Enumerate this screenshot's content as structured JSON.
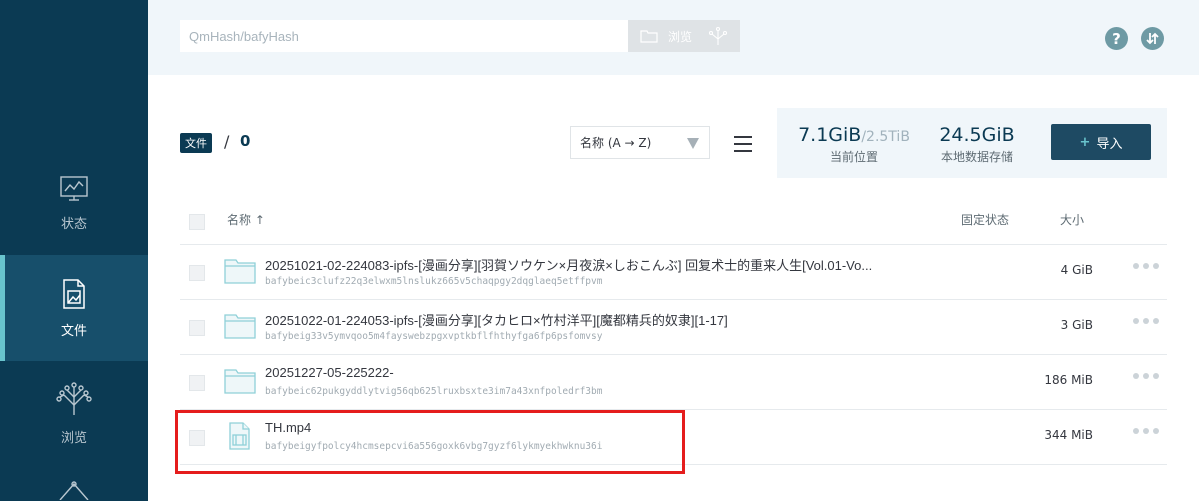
{
  "sidebar": {
    "items": [
      {
        "id": "status",
        "label": "状态",
        "icon": "chart-monitor-icon",
        "active": false
      },
      {
        "id": "files",
        "label": "文件",
        "icon": "document-icon",
        "active": true
      },
      {
        "id": "explore",
        "label": "浏览",
        "icon": "tree-graph-icon",
        "active": false
      },
      {
        "id": "peers",
        "label": "",
        "icon": "hexagon-network-icon",
        "active": false
      }
    ]
  },
  "header": {
    "search_placeholder": "QmHash/bafyHash",
    "browse_label": "浏览"
  },
  "breadcrumb": {
    "root": "文件",
    "separator": "/",
    "current": "0"
  },
  "sort": {
    "selected": "名称 (A → Z)"
  },
  "stats": {
    "current_value": "7.1GiB",
    "current_total": "/2.5TiB",
    "current_label": "当前位置",
    "local_value": "24.5GiB",
    "local_label": "本地数据存储"
  },
  "import": {
    "plus": "+",
    "label": "导入"
  },
  "table": {
    "col_name": "名称 ↑",
    "col_pin": "固定状态",
    "col_size": "大小",
    "rows": [
      {
        "type": "folder",
        "name": "20251021-02-224083-ipfs-[漫画分享][羽賀ソウケン×月夜涙×しおこんぶ] 回复术士的重来人生[Vol.01-Vo...",
        "cid": "bafybeic3clufz22q3elwxm5lnslukz665v5chaqpgy2dqglaeq5etffpvm",
        "size": "4 GiB"
      },
      {
        "type": "folder",
        "name": "20251022-01-224053-ipfs-[漫画分享][タカヒロ×竹村洋平][魔都精兵的奴隶][1-17]",
        "cid": "bafybeig33v5ymvqoo5m4fayswebzpgxvptkbflfhthyfga6fp6psfomvsy",
        "size": "3 GiB"
      },
      {
        "type": "folder",
        "name": "20251227-05-225222-",
        "cid": "bafybeic62pukgyddlytvig56qb625lruxbsxte3im7a43xnfpoledrf3bm",
        "size": "186 MiB"
      },
      {
        "type": "video",
        "name": "TH.mp4",
        "cid": "bafybeigyfpolcy4hcmsepcvi6a556goxk6vbg7gyzf6lykmyekhwknu36i",
        "size": "344 MiB"
      }
    ]
  },
  "colors": {
    "sidebar_bg": "#0b3a53",
    "sidebar_active": "#174f6b",
    "accent": "#69c4cd",
    "highlight": "#e51d1d"
  }
}
